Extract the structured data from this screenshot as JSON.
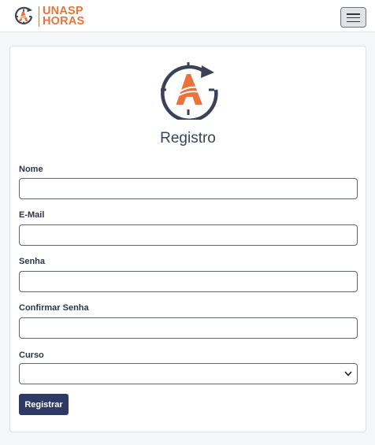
{
  "navbar": {
    "brand_line1": "UNASP",
    "brand_line2": "HORAS",
    "menu_icon": "hamburger-icon"
  },
  "form": {
    "title": "Registro",
    "fields": {
      "nome": {
        "label": "Nome",
        "value": ""
      },
      "email": {
        "label": "E-Mail",
        "value": ""
      },
      "senha": {
        "label": "Senha",
        "value": ""
      },
      "confirmar": {
        "label": "Confirmar Senha",
        "value": ""
      },
      "curso": {
        "label": "Curso",
        "selected": ""
      }
    },
    "submit_label": "Registrar"
  },
  "colors": {
    "brand_orange": "#e8743b",
    "navy": "#2e3a63",
    "page_bg": "#f4f6f8"
  }
}
